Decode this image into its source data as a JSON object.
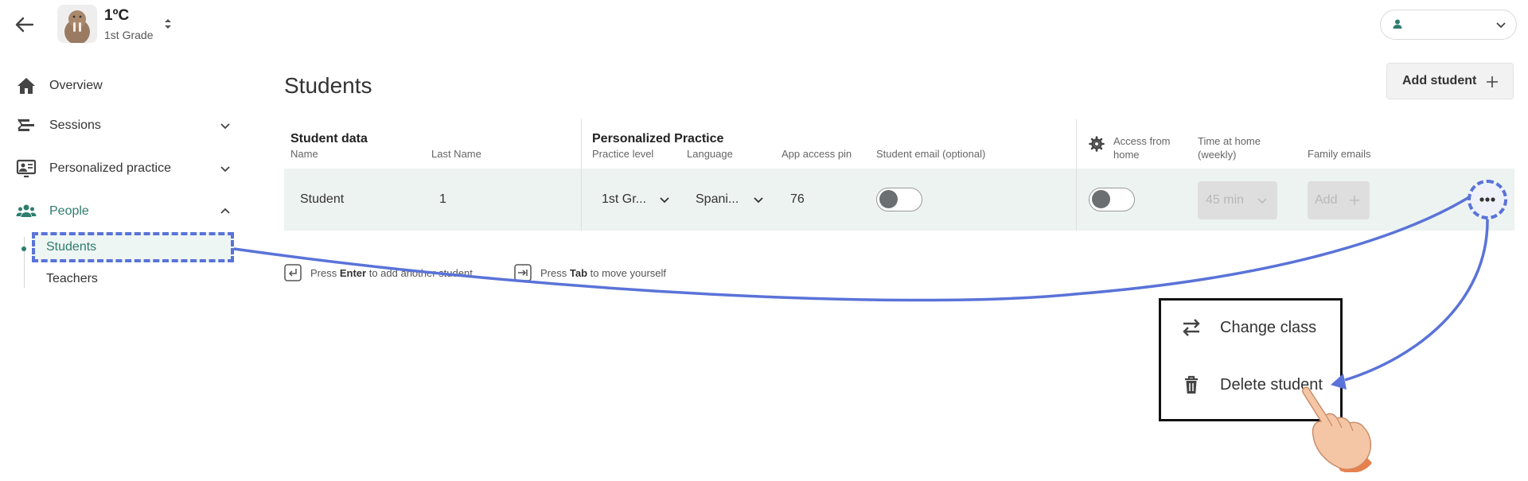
{
  "header": {
    "class_name": "1ºC",
    "class_grade": "1st Grade"
  },
  "sidebar": {
    "items": [
      {
        "label": "Overview",
        "icon": "home-icon"
      },
      {
        "label": "Sessions",
        "icon": "sessions-icon"
      },
      {
        "label": "Personalized practice",
        "icon": "practice-icon"
      },
      {
        "label": "People",
        "icon": "people-icon"
      }
    ],
    "people_sub": [
      {
        "label": "Students"
      },
      {
        "label": "Teachers"
      }
    ]
  },
  "main": {
    "title": "Students",
    "add_student_label": "Add student",
    "groups": {
      "student_data": "Student data",
      "personalized_practice": "Personalized Practice"
    },
    "columns": {
      "name": "Name",
      "last_name": "Last Name",
      "practice_level": "Practice level",
      "language": "Language",
      "app_access_pin": "App access pin",
      "student_email": "Student email (optional)",
      "access_from_home": "Access from home",
      "time_at_home": "Time at home (weekly)",
      "family_emails": "Family emails"
    },
    "row": {
      "name": "Student",
      "last_name": "1",
      "practice_level": "1st Gr...",
      "language": "Spani...",
      "pin": "76",
      "student_email_toggle": false,
      "access_from_home_toggle": false,
      "time_at_home": "45 min",
      "family_emails_add": "Add"
    },
    "hints": {
      "enter_prefix": "Press",
      "enter_key": "Enter",
      "enter_suffix": "to add another student",
      "tab_prefix": "Press",
      "tab_key": "Tab",
      "tab_suffix": "to move yourself"
    }
  },
  "context_menu": {
    "items": [
      {
        "label": "Change class",
        "icon": "swap-icon"
      },
      {
        "label": "Delete student",
        "icon": "trash-icon"
      }
    ]
  },
  "colors": {
    "accent": "#2e7d6e",
    "annotation": "#5a73d8",
    "row_bg": "#edf3f1"
  }
}
